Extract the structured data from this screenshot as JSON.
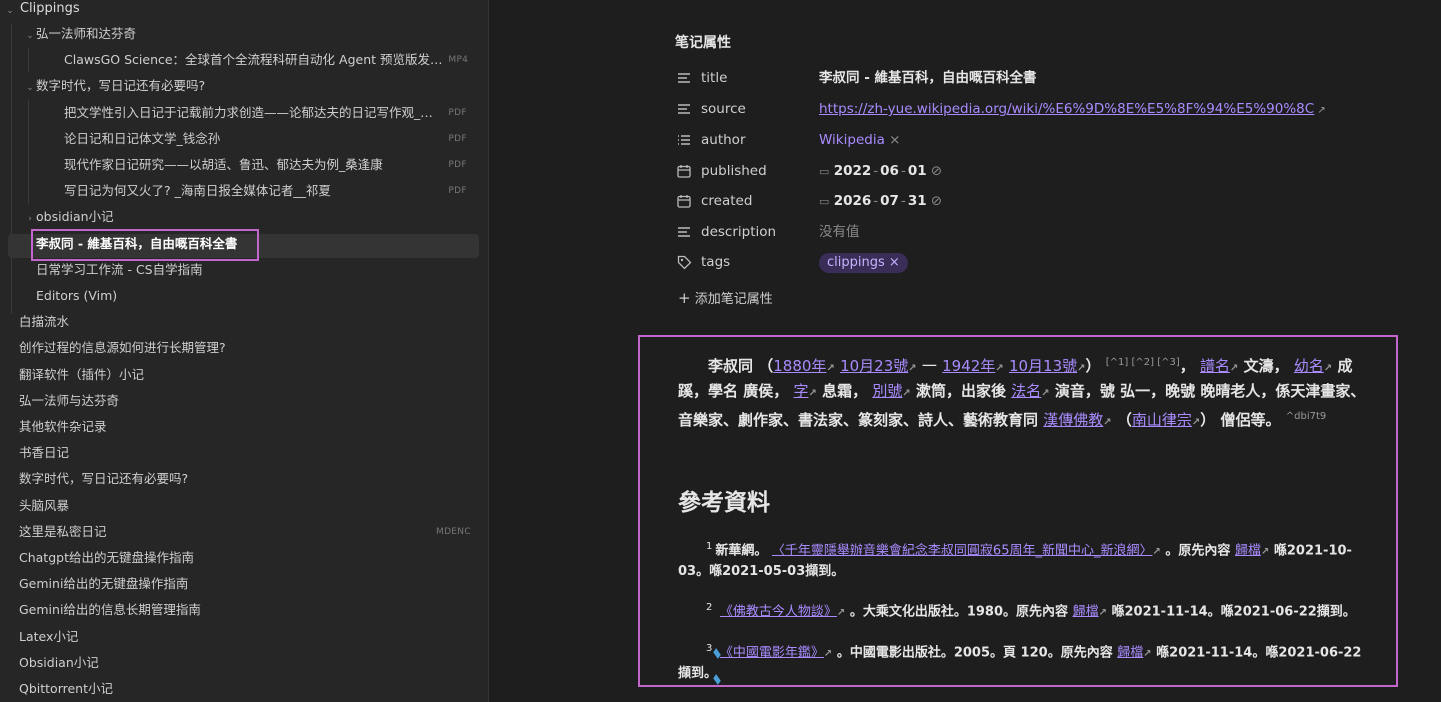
{
  "sidebar": {
    "root": "Clippings",
    "items": [
      {
        "label": "弘一法师和达芬奇",
        "level": 1,
        "chevron": "down"
      },
      {
        "label": "ClawsGO Science：全球首个全流程科研自动化 Agent 预览版发…",
        "level": 2,
        "badge": "MP4"
      },
      {
        "label": "数字时代，写日记还有必要吗?",
        "level": 1,
        "chevron": "down"
      },
      {
        "label": "把文学性引入日记于记载前力求创造——论郁达夫的日记写作观_刘…",
        "level": 2,
        "badge": "PDF"
      },
      {
        "label": "论日记和日记体文学_钱念孙",
        "level": 2,
        "badge": "PDF"
      },
      {
        "label": "现代作家日记研究——以胡适、鲁迅、郁达夫为例_桑逢康",
        "level": 2,
        "badge": "PDF"
      },
      {
        "label": "写日记为何又火了? _海南日报全媒体记者__祁夏",
        "level": 2,
        "badge": "PDF"
      },
      {
        "label": "obsidian小记",
        "level": 1,
        "chevron": "right"
      },
      {
        "label": "李叔同 - 維基百科，自由嘅百科全書",
        "level": 1,
        "active": true
      },
      {
        "label": "日常学习工作流 - CS自学指南",
        "level": 1
      },
      {
        "label": "Editors (Vim)",
        "level": 1
      },
      {
        "label": "白描流水",
        "level": 0
      },
      {
        "label": "创作过程的信息源如何进行长期管理?",
        "level": 0
      },
      {
        "label": "翻译软件（插件）小记",
        "level": 0
      },
      {
        "label": "弘一法师与达芬奇",
        "level": 0
      },
      {
        "label": "其他软件杂记录",
        "level": 0
      },
      {
        "label": "书香日记",
        "level": 0
      },
      {
        "label": "数字时代，写日记还有必要吗?",
        "level": 0
      },
      {
        "label": "头脑风暴",
        "level": 0
      },
      {
        "label": "这里是私密日记",
        "level": 0,
        "badge": "MDENC"
      },
      {
        "label": "Chatgpt给出的无键盘操作指南",
        "level": 0
      },
      {
        "label": "Gemini给出的无键盘操作指南",
        "level": 0
      },
      {
        "label": "Gemini给出的信息长期管理指南",
        "level": 0
      },
      {
        "label": "Latex小记",
        "level": 0
      },
      {
        "label": "Obsidian小记",
        "level": 0
      },
      {
        "label": "Qbittorrent小记",
        "level": 0
      }
    ]
  },
  "properties": {
    "heading": "笔记属性",
    "title": {
      "key": "title",
      "value": "李叔同 - 維基百科，自由嘅百科全書"
    },
    "source": {
      "key": "source",
      "value": "https://zh-yue.wikipedia.org/wiki/%E6%9D%8E%E5%8F%94%E5%90%8C"
    },
    "author": {
      "key": "author",
      "value": "Wikipedia"
    },
    "published": {
      "key": "published",
      "y": "2022",
      "m": "06",
      "d": "01"
    },
    "created": {
      "key": "created",
      "y": "2026",
      "m": "07",
      "d": "31"
    },
    "description": {
      "key": "description",
      "value": "没有值"
    },
    "tags": {
      "key": "tags",
      "value": "clippings"
    },
    "add_label": "添加笔记属性"
  },
  "article": {
    "p": {
      "name": "李叔同",
      "l_1880": "1880年",
      "l_1023": "10月23號",
      "dash": "一",
      "l_1942": "1942年",
      "l_1013": "10月13號",
      "refs": "[^1] [^2] [^3]",
      "l_puming": "譜名",
      "t1": "文濤，",
      "l_youming": "幼名",
      "t2": "成蹊，學名 廣侯，",
      "l_zi": "字",
      "t3": "息霜，",
      "l_biehao": "別號",
      "t4": "漱筒，出家後",
      "l_faming": "法名",
      "t5": "演音，號 弘一，晚號 晚晴老人，係天津畫家、音樂家、劇作家、書法家、篆刻家、詩人、藝術教育同",
      "l_hanchuan": "漢傳佛教",
      "l_nanshan": "南山律宗",
      "t6": "僧侶等。",
      "block_id": "^dbi7t9"
    },
    "ref_heading": "參考資料",
    "refs": [
      {
        "num": "1",
        "pre": "新華網。",
        "link": "〈千年靈隱舉辦音樂會紀念李叔同圓寂65周年_新聞中心_新浪網〉",
        "mid": "。原先內容",
        "archive": "歸檔",
        "post": "喺2021-10-03。喺2021-05-03擷到。"
      },
      {
        "num": "2",
        "pre": "",
        "link": "《佛教古今人物談》",
        "mid": "。大乘文化出版社。1980。原先內容",
        "archive": "歸檔",
        "post": "喺2021-11-14。喺2021-06-22擷到。"
      },
      {
        "num": "3",
        "pre": "",
        "link": "《中國電影年鑑》",
        "mid": "。中國電影出版社。2005。頁 120。原先內容",
        "archive": "歸檔",
        "post": "喺2021-11-14。喺2021-06-22擷到。"
      }
    ]
  },
  "colors": {
    "accent": "#a98bff",
    "highlight_border": "#c266cc",
    "sidebar_bg": "#262626",
    "main_bg": "#1e1e1e"
  }
}
